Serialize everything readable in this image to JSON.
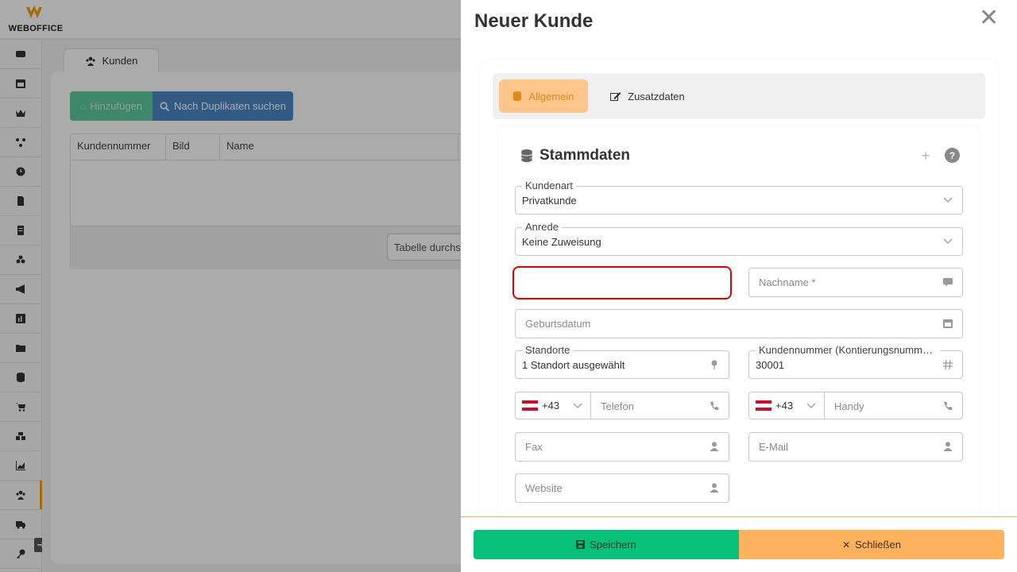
{
  "app": {
    "logo_text": "WEBOFFICE",
    "sidebar_icons": [
      "dashboard-icon",
      "calendar-icon",
      "crown-icon",
      "network-icon",
      "clock-icon",
      "document-icon",
      "list-icon",
      "boxes-icon",
      "megaphone-icon",
      "chart-icon",
      "folder-icon",
      "database-icon",
      "cart-icon",
      "warehouse-icon",
      "stats-icon",
      "customers-icon",
      "truck-icon",
      "key-icon"
    ],
    "active_sidebar_index": 15,
    "tab_label": "Kunden",
    "add_button": "Hinzufügen",
    "duplicates_button": "Nach Duplikaten suchen",
    "table_columns": [
      "Kundennummer",
      "Bild",
      "Name"
    ],
    "table_search_placeholder": "Tabelle durchsuchen"
  },
  "drawer": {
    "title": "Neuer Kunde",
    "tabs": [
      {
        "label": "Allgemein",
        "active": true
      },
      {
        "label": "Zusatzdaten",
        "active": false
      }
    ],
    "section_title": "Stammdaten",
    "fields": {
      "kundenart": {
        "label": "Kundenart",
        "value": "Privatkunde"
      },
      "anrede": {
        "label": "Anrede",
        "value": "Keine Zuweisung"
      },
      "vorname": {
        "value": ""
      },
      "nachname": {
        "placeholder": "Nachname *"
      },
      "geburtsdatum": {
        "placeholder": "Geburtsdatum"
      },
      "standorte": {
        "label": "Standorte",
        "value": "1 Standort ausgewählt"
      },
      "kundennummer": {
        "label": "Kundennummer (Kontierungsnummer...",
        "value": "30001"
      },
      "telefon": {
        "country_code": "+43",
        "placeholder": "Telefon"
      },
      "handy": {
        "country_code": "+43",
        "placeholder": "Handy"
      },
      "fax": {
        "placeholder": "Fax"
      },
      "email": {
        "placeholder": "E-Mail"
      },
      "website": {
        "placeholder": "Website"
      }
    },
    "save_button": "Speichern",
    "close_button": "Schließen"
  },
  "colors": {
    "accent_orange": "#f59e0b",
    "save_green": "#07c07a",
    "close_orange": "#ffb25e",
    "error_red": "#e10000",
    "duplicates_blue": "#4a86c5"
  }
}
